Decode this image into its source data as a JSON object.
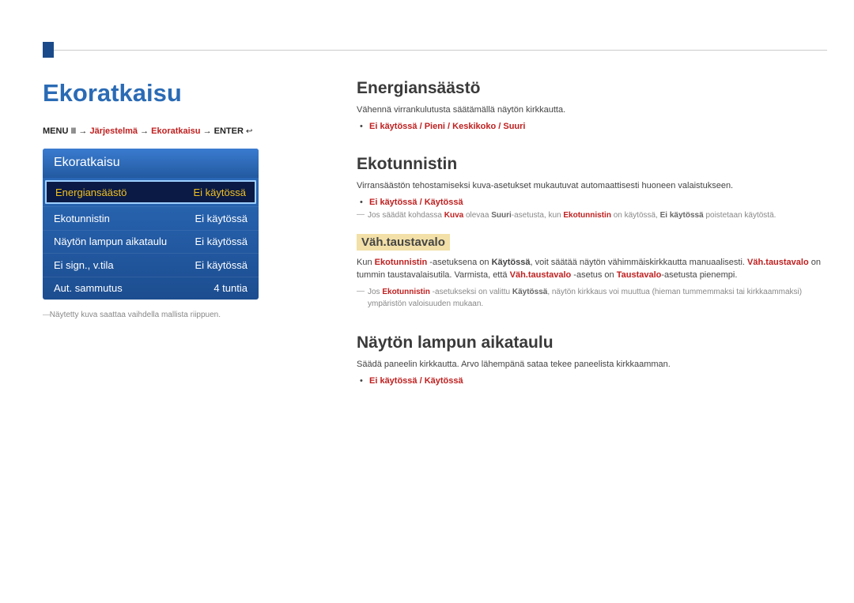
{
  "page_title": "Ekoratkaisu",
  "breadcrumb": {
    "menu": "MENU",
    "path1": "Järjestelmä",
    "path2": "Ekoratkaisu",
    "enter": "ENTER"
  },
  "menu": {
    "header": "Ekoratkaisu",
    "rows": [
      {
        "label": "Energiansäästö",
        "value": "Ei käytössä",
        "selected": true
      },
      {
        "label": "Ekotunnistin",
        "value": "Ei käytössä",
        "selected": false
      },
      {
        "label": "Näytön lampun aikataulu",
        "value": "Ei käytössä",
        "selected": false
      },
      {
        "label": "Ei sign., v.tila",
        "value": "Ei käytössä",
        "selected": false
      },
      {
        "label": "Aut. sammutus",
        "value": "4 tuntia",
        "selected": false
      }
    ]
  },
  "caption": "Näytetty kuva saattaa vaihdella mallista riippuen.",
  "sections": {
    "energiansaasto": {
      "title": "Energiansäästö",
      "desc": "Vähennä virrankulutusta säätämällä näytön kirkkautta.",
      "options": "Ei käytössä / Pieni / Keskikoko / Suuri"
    },
    "ekotunnistin": {
      "title": "Ekotunnistin",
      "desc": "Virransäästön tehostamiseksi kuva-asetukset mukautuvat automaattisesti huoneen valaistukseen.",
      "options": "Ei käytössä / Käytössä",
      "note1_pre": "Jos säädät kohdassa ",
      "note1_kuva": "Kuva",
      "note1_mid1": " olevaa ",
      "note1_suuri": "Suuri",
      "note1_mid2": "-asetusta, kun ",
      "note1_eko": "Ekotunnistin",
      "note1_mid3": " on käytössä, ",
      "note1_off": "Ei käytössä",
      "note1_end": " poistetaan käytöstä."
    },
    "vahtaustavalo": {
      "title": "Väh.taustavalo",
      "desc_pre": "Kun ",
      "desc_eko": "Ekotunnistin",
      "desc_mid1": " -asetuksena on ",
      "desc_on": "Käytössä",
      "desc_mid2": ", voit säätää näytön vähimmäiskirkkautta manuaalisesti. ",
      "desc_vt": "Väh.taustavalo",
      "desc_mid3": " on tummin taustavalaisutila. Varmista, että ",
      "desc_vt2": "Väh.taustavalo",
      "desc_mid4": " -asetus on ",
      "desc_tv": "Taustavalo",
      "desc_end": "-asetusta pienempi.",
      "note2_pre": "Jos ",
      "note2_eko": "Ekotunnistin",
      "note2_mid1": " -asetukseksi on valittu ",
      "note2_on": "Käytössä",
      "note2_end": ", näytön kirkkaus voi muuttua (hieman tummemmaksi tai kirkkaammaksi) ympäristön valoisuuden mukaan."
    },
    "nayton": {
      "title": "Näytön lampun aikataulu",
      "desc": "Säädä paneelin kirkkautta. Arvo lähempänä sataa tekee paneelista kirkkaamman.",
      "options": "Ei käytössä / Käytössä"
    }
  }
}
